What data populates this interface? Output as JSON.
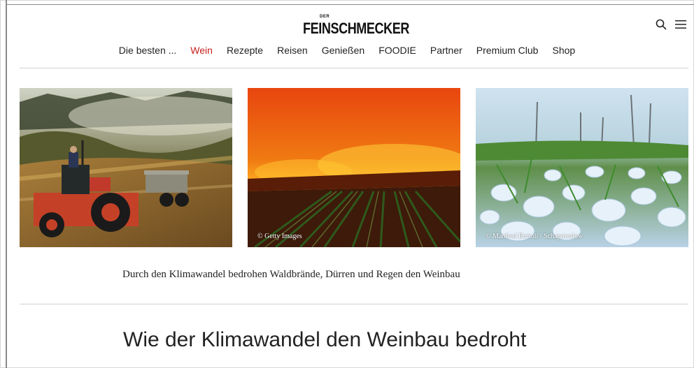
{
  "brand": {
    "logo_small": "DER",
    "logo_main": "FEINSCHMECKER"
  },
  "header_icons": [
    {
      "icon": "search-icon"
    },
    {
      "icon": "menu-icon"
    }
  ],
  "nav": {
    "items": [
      {
        "label": "Die besten ...",
        "active": false
      },
      {
        "label": "Wein",
        "active": true
      },
      {
        "label": "Rezepte",
        "active": false
      },
      {
        "label": "Reisen",
        "active": false
      },
      {
        "label": "Genießen",
        "active": false
      },
      {
        "label": "FOODIE",
        "active": false
      },
      {
        "label": "Partner",
        "active": false
      },
      {
        "label": "Premium Club",
        "active": false
      },
      {
        "label": "Shop",
        "active": false
      }
    ],
    "active_color": "#c8201f"
  },
  "gallery": {
    "images": [
      {
        "subject": "tractor in vineyard with fog",
        "credit": ""
      },
      {
        "subject": "wildfire over vineyard",
        "credit": "© Getty Images"
      },
      {
        "subject": "hailstones on grass",
        "credit": "© Manfred Bortoli / Schapowalow"
      }
    ]
  },
  "article": {
    "caption": "Durch den Klimawandel bedrohen Waldbrände, Dürren und Regen den Weinbau",
    "headline": "Wie der Klimawandel den Weinbau bedroht"
  }
}
